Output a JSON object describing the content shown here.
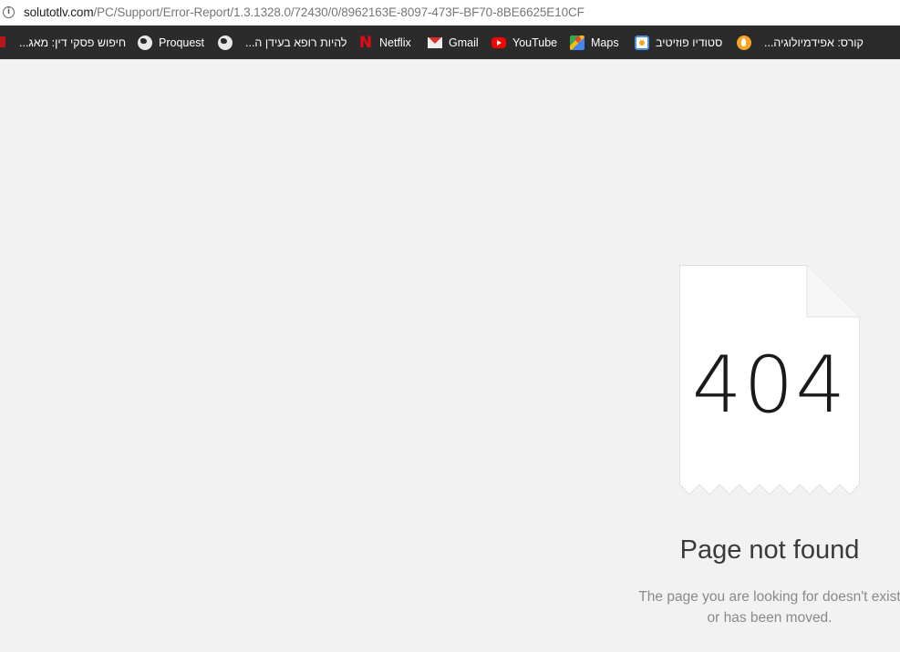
{
  "browser": {
    "url_domain": "solutotlv.com",
    "url_path": "/PC/Support/Error-Report/1.3.1328.0/72430/0/8962163E-8097-473F-BF70-8BE6625E10CF",
    "info_icon_glyph": "i"
  },
  "bookmarks": [
    {
      "label": "חיפוש פסקי דין: מאג...",
      "icon": "red-page-icon"
    },
    {
      "label": "Proquest",
      "icon": "globe-icon"
    },
    {
      "label": "להיות רופא בעידן ה...",
      "icon": "globe-icon"
    },
    {
      "label": "Netflix",
      "icon": "netflix-icon"
    },
    {
      "label": "Gmail",
      "icon": "gmail-icon"
    },
    {
      "label": "YouTube",
      "icon": "youtube-icon"
    },
    {
      "label": "Maps",
      "icon": "maps-icon"
    },
    {
      "label": "סטודיו פוזיטיב",
      "icon": "studio-icon"
    },
    {
      "label": "קורס: אפידמיולוגיה...",
      "icon": "course-icon"
    }
  ],
  "error": {
    "code": "404",
    "title": "Page not found",
    "message": "The page you are looking for doesn't exist or has been moved."
  },
  "colors": {
    "page_background": "#f2f2f2",
    "bookmarks_bar": "#2b2b2b",
    "paper": "#ffffff",
    "title_text": "#3a3a3a",
    "message_text": "#8a8a8a"
  }
}
